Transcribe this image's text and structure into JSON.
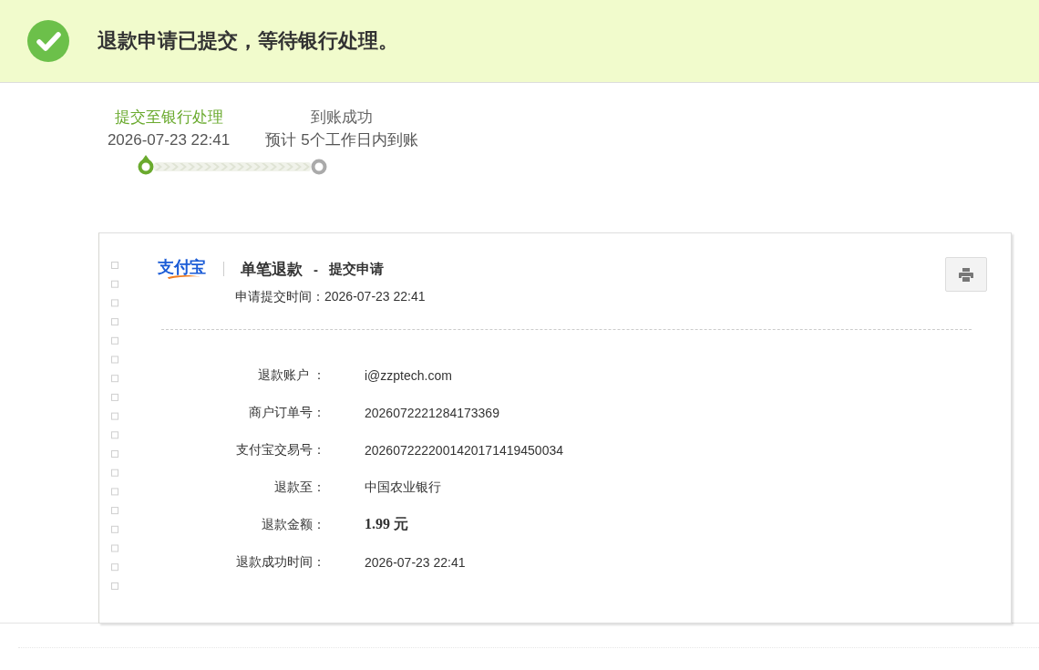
{
  "banner": {
    "kind": "success",
    "message": "退款申请已提交，等待银行处理。"
  },
  "progress": {
    "steps": [
      {
        "label": "提交至银行处理",
        "detail": "2026-07-23 22:41",
        "done": true
      },
      {
        "label": "到账成功",
        "detail": "预计 5个工作日内到账",
        "done": false
      }
    ]
  },
  "receipt": {
    "logo": "支付宝",
    "title": "单笔退款",
    "dash": "-",
    "subtitle": "提交申请",
    "submitted": "申请提交时间：2026-07-23 22:41",
    "fields": [
      {
        "label": "退款账户 ：",
        "value": "i@zzptech.com",
        "emphasis": false
      },
      {
        "label": "商户订单号：",
        "value": "2026072221284173369",
        "emphasis": false
      },
      {
        "label": "支付宝交易号：",
        "value": "2026072222001420171419450034",
        "emphasis": false
      },
      {
        "label": "退款至：",
        "value": "中国农业银行",
        "emphasis": false
      },
      {
        "label": "退款金额：",
        "value": "1.99 元",
        "emphasis": true
      },
      {
        "label": "退款成功时间：",
        "value": "2026-07-23 22:41",
        "emphasis": false
      }
    ]
  }
}
